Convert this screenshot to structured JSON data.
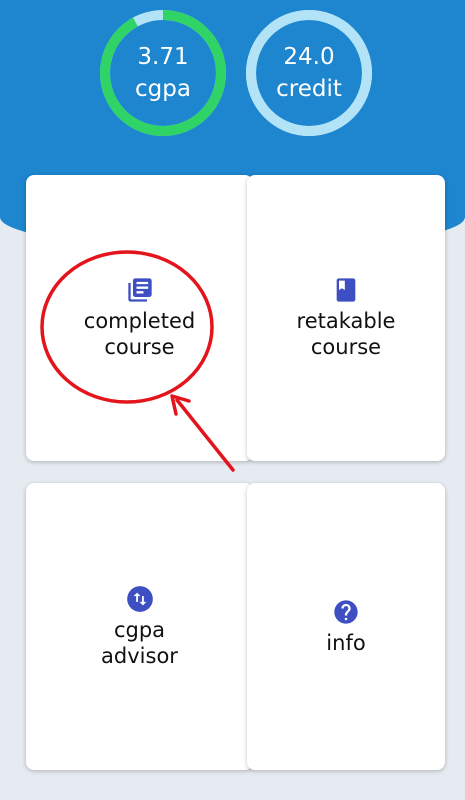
{
  "stats": {
    "cgpa": {
      "value": "3.71",
      "label": "cgpa",
      "progress": 0.92,
      "color": "#2fd366"
    },
    "credit": {
      "value": "24.0",
      "label": "credit",
      "progress": 1.0,
      "color": "#b3e3f7"
    }
  },
  "menu": [
    {
      "label": "completed\ncourse",
      "icon": "list-document-icon"
    },
    {
      "label": "retakable\ncourse",
      "icon": "book-icon"
    },
    {
      "label": "cgpa\nadvisor",
      "icon": "swap-vertical-icon"
    },
    {
      "label": "info",
      "icon": "help-circle-icon"
    }
  ],
  "colors": {
    "header": "#1d86cf",
    "background": "#e6ebf1",
    "icon": "#3d4fc3",
    "annotation": "#e3141b",
    "gauge_track": "#b3e3f7"
  }
}
